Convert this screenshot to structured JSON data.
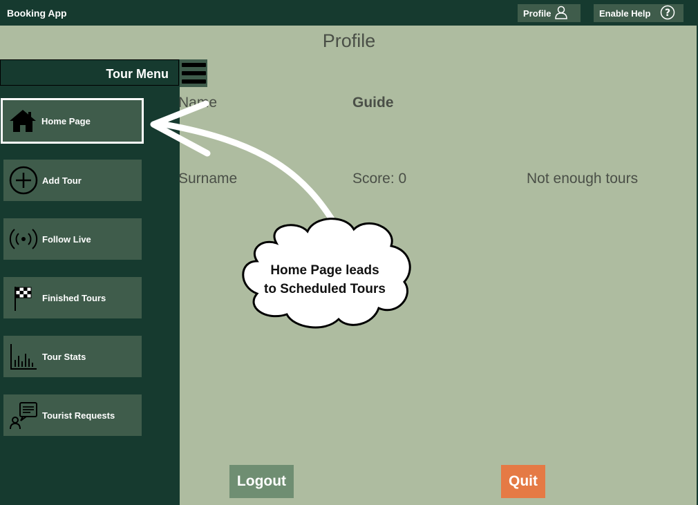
{
  "app": {
    "title": "Booking App"
  },
  "topbar": {
    "profile_label": "Profile",
    "help_label": "Enable Help"
  },
  "page": {
    "title": "Profile"
  },
  "menu": {
    "title": "Tour Menu",
    "items": [
      {
        "label": "Home Page",
        "icon": "home-icon"
      },
      {
        "label": "Add Tour",
        "icon": "add-circle-icon"
      },
      {
        "label": "Follow Live",
        "icon": "broadcast-icon"
      },
      {
        "label": "Finished Tours",
        "icon": "checkered-flag-icon"
      },
      {
        "label": "Tour Stats",
        "icon": "bar-chart-icon"
      },
      {
        "label": "Tourist Requests",
        "icon": "user-message-icon"
      }
    ]
  },
  "profile": {
    "name_label": "Name",
    "role": "Guide",
    "surname_label": "Surname",
    "score": "Score: 0",
    "rating_status": "Not enough tours"
  },
  "buttons": {
    "logout": "Logout",
    "quit": "Quit"
  },
  "annotation": {
    "line1": "Home Page leads",
    "line2": "to Scheduled Tours"
  },
  "colors": {
    "sidebar": "#163a2f",
    "content": "#aebca0",
    "menu_item": "#3f5c4b",
    "quit": "#e57a45",
    "logout": "#6f8e72"
  }
}
